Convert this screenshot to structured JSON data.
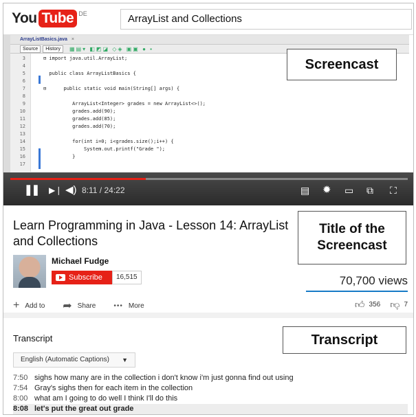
{
  "header": {
    "logo_you": "You",
    "logo_tube": "Tube",
    "logo_region": "DE",
    "search_value": "ArrayList and Collections"
  },
  "ide": {
    "file_tab": "ArrayListBasics.java",
    "tab_close": "×",
    "toolbar_source": "Source",
    "toolbar_history": "History",
    "lines": [
      {
        "n": "3",
        "code": "⊟ import java.util.ArrayList;"
      },
      {
        "n": "4",
        "code": ""
      },
      {
        "n": "5",
        "code": "  public class ArrayListBasics {"
      },
      {
        "n": "6",
        "code": ""
      },
      {
        "n": "7",
        "code": "⊟      public static void main(String[] args) {"
      },
      {
        "n": "8",
        "code": ""
      },
      {
        "n": "9",
        "code": "          ArrayList<Integer> grades = new ArrayList<>();"
      },
      {
        "n": "10",
        "code": "          grades.add(90);"
      },
      {
        "n": "11",
        "code": "          grades.add(85);"
      },
      {
        "n": "12",
        "code": "          grades.add(70);"
      },
      {
        "n": "13",
        "code": ""
      },
      {
        "n": "14",
        "code": "          for(int i=0; i<grades.size();i++) {"
      },
      {
        "n": "15",
        "code": "              System.out.printf(\"Grade \");"
      },
      {
        "n": "16",
        "code": "          }"
      },
      {
        "n": "17",
        "code": ""
      }
    ]
  },
  "annotations": {
    "screencast": "Screencast",
    "title": "Title of the Screencast",
    "transcript": "Transcript"
  },
  "player": {
    "time": "8:11 / 24:22",
    "progress": 0.34
  },
  "video": {
    "title": "Learn Programming in Java - Lesson 14: ArrayList and Collections",
    "channel": "Michael Fudge",
    "subscribe_label": "Subscribe",
    "subscriber_count": "16,515",
    "views": "70,700 views",
    "add_to": "Add to",
    "share": "Share",
    "more": "More",
    "likes": "356",
    "dislikes": "7"
  },
  "transcript": {
    "heading": "Transcript",
    "language": "English (Automatic Captions)",
    "lines": [
      {
        "ts": "7:50",
        "text": "sighs how many are in the collection i don't know i'm just gonna find out using"
      },
      {
        "ts": "7:54",
        "text": "Gray's sighs then for each item in the collection"
      },
      {
        "ts": "8:00",
        "text": "what am I going to do well I think I'll do this"
      },
      {
        "ts": "8:08",
        "text": "let's put the great out grade"
      }
    ]
  }
}
